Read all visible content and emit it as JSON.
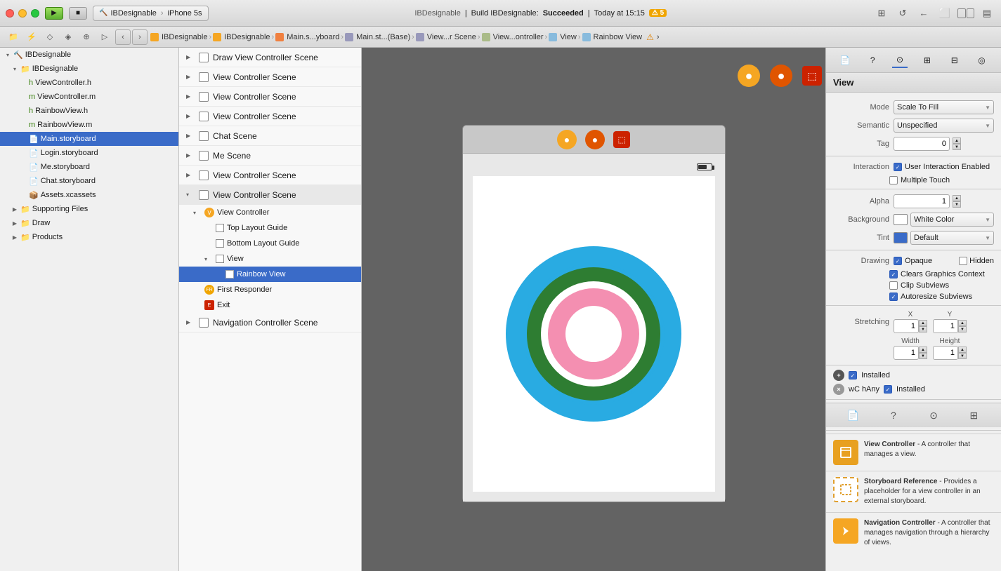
{
  "window": {
    "title": "IBDesignable"
  },
  "topbar": {
    "app_icon": "🔨",
    "scheme": "IBDesignable",
    "device": "iPhone 5s",
    "status_app": "IBDesignable",
    "status_build": "Build IBDesignable:",
    "status_result": "Succeeded",
    "status_time": "Today at 15:15",
    "warning_count": "5"
  },
  "breadcrumb": {
    "items": [
      {
        "label": "IBDesignable",
        "icon_color": "#f5a623"
      },
      {
        "label": "IBDesignable",
        "icon_color": "#f5a623"
      },
      {
        "label": "Main.s...yboard",
        "icon_color": "#f08040"
      },
      {
        "label": "Main.st...(Base)",
        "icon_color": "#8888aa"
      },
      {
        "label": "View...r Scene",
        "icon_color": "#8888aa"
      },
      {
        "label": "View...ontroller",
        "icon_color": "#aabb88"
      },
      {
        "label": "View",
        "icon_color": "#88bbdd"
      },
      {
        "label": "Rainbow View",
        "icon_color": "#88bbdd"
      }
    ]
  },
  "file_nav": {
    "root": "IBDesignable",
    "group": "IBDesignable",
    "files": [
      {
        "name": "ViewController.h",
        "type": "h",
        "indent": 2
      },
      {
        "name": "ViewController.m",
        "type": "m",
        "indent": 2
      },
      {
        "name": "RainbowView.h",
        "type": "h",
        "indent": 2
      },
      {
        "name": "RainbowView.m",
        "type": "m",
        "indent": 2
      },
      {
        "name": "Main.storyboard",
        "type": "storyboard",
        "indent": 2,
        "selected": true
      },
      {
        "name": "Login.storyboard",
        "type": "storyboard",
        "indent": 2
      },
      {
        "name": "Me.storyboard",
        "type": "storyboard",
        "indent": 2
      },
      {
        "name": "Chat.storyboard",
        "type": "storyboard",
        "indent": 2
      },
      {
        "name": "Assets.xcassets",
        "type": "assets",
        "indent": 2
      },
      {
        "name": "Supporting Files",
        "type": "folder",
        "indent": 1
      },
      {
        "name": "Draw",
        "type": "folder",
        "indent": 1
      },
      {
        "name": "Products",
        "type": "folder",
        "indent": 1
      }
    ]
  },
  "scenes": [
    {
      "label": "Draw View Controller Scene",
      "expanded": false,
      "indent": 0
    },
    {
      "label": "View Controller Scene",
      "expanded": false,
      "indent": 0
    },
    {
      "label": "View Controller Scene",
      "expanded": false,
      "indent": 0
    },
    {
      "label": "View Controller Scene",
      "expanded": false,
      "indent": 0
    },
    {
      "label": "Chat Scene",
      "expanded": false,
      "indent": 0
    },
    {
      "label": "Me Scene",
      "expanded": false,
      "indent": 0
    },
    {
      "label": "View Controller Scene",
      "expanded": false,
      "indent": 0
    },
    {
      "label": "View Controller Scene",
      "expanded": true,
      "indent": 0,
      "children": [
        {
          "label": "View Controller",
          "type": "vc",
          "indent": 1,
          "expanded": true,
          "children": [
            {
              "label": "Top Layout Guide",
              "type": "layout",
              "indent": 2
            },
            {
              "label": "Bottom Layout Guide",
              "type": "layout",
              "indent": 2
            },
            {
              "label": "View",
              "type": "view",
              "indent": 2,
              "expanded": true,
              "children": [
                {
                  "label": "Rainbow View",
                  "type": "view",
                  "indent": 3,
                  "selected": true
                }
              ]
            }
          ]
        },
        {
          "label": "First Responder",
          "type": "fr",
          "indent": 1
        },
        {
          "label": "Exit",
          "type": "exit",
          "indent": 1
        }
      ]
    },
    {
      "label": "Navigation Controller Scene",
      "expanded": false,
      "indent": 0
    }
  ],
  "canvas": {
    "phone_icons": [
      {
        "color": "#f5a623",
        "symbol": "⬤"
      },
      {
        "color": "#e05500",
        "symbol": "⬤"
      },
      {
        "color": "#cc2200",
        "symbol": "⬤"
      }
    ],
    "battery": "battery",
    "circles": [
      {
        "color": "#29abe2",
        "size": 260
      },
      {
        "color": "#2e7d32",
        "size": 200
      },
      {
        "color": "#f48fb1",
        "size": 140
      },
      {
        "color": "white",
        "size": 80
      }
    ]
  },
  "right_panel": {
    "title": "View",
    "properties": {
      "mode_label": "Mode",
      "mode_value": "Scale To Fill",
      "semantic_label": "Semantic",
      "semantic_value": "Unspecified",
      "tag_label": "Tag",
      "tag_value": "0",
      "interaction_label": "Interaction",
      "user_interaction": "User Interaction Enabled",
      "multiple_touch": "Multiple Touch",
      "alpha_label": "Alpha",
      "alpha_value": "1",
      "background_label": "Background",
      "background_value": "White Color",
      "tint_label": "Tint",
      "tint_value": "Default",
      "drawing_label": "Drawing",
      "opaque": "Opaque",
      "hidden": "Hidden",
      "clears_graphics": "Clears Graphics Context",
      "clip_subviews": "Clip Subviews",
      "autoresize": "Autoresize Subviews",
      "stretching_label": "Stretching",
      "x_label": "X",
      "y_label": "Y",
      "width_label": "Width",
      "height_label": "Height",
      "x_val": "1",
      "y_val": "1",
      "w_val": "1",
      "h_val": "1"
    },
    "installed": {
      "installed_label": "Installed",
      "wchany_label": "wC hAny",
      "installed_label2": "Installed"
    },
    "descriptions": [
      {
        "title": "View Controller",
        "desc": "A controller that manages a view.",
        "icon_type": "solid"
      },
      {
        "title": "Storyboard Reference",
        "desc": "Provides a placeholder for a view controller in an external storyboard.",
        "icon_type": "dashed"
      },
      {
        "title": "Navigation Controller",
        "desc": "A controller that manages navigation through a hierarchy of views.",
        "icon_type": "nav"
      }
    ]
  }
}
